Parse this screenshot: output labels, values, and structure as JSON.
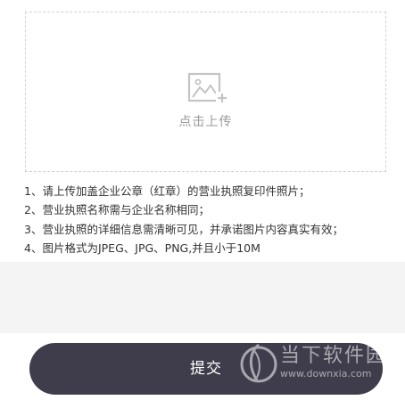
{
  "upload": {
    "icon": "image-add-icon",
    "label": "点击上传"
  },
  "notes": [
    "1、请上传加盖企业公章（红章）的营业执照复印件照片；",
    "2、营业执照名称需与企业名称相同；",
    "3、营业执照的详细信息需清晰可见，并承诺图片内容真实有效；",
    "4、图片格式为JPEG、JPG、PNG,并且小于10M"
  ],
  "submit": {
    "label": "提交"
  },
  "watermark": {
    "title": "当下软件园",
    "url": "www.downxia.com"
  },
  "colors": {
    "button_bg": "#3f3d4b",
    "page_gray": "#f4f4f5",
    "dashed_border": "#d2d2d2",
    "muted_text": "#9a9a9a"
  }
}
